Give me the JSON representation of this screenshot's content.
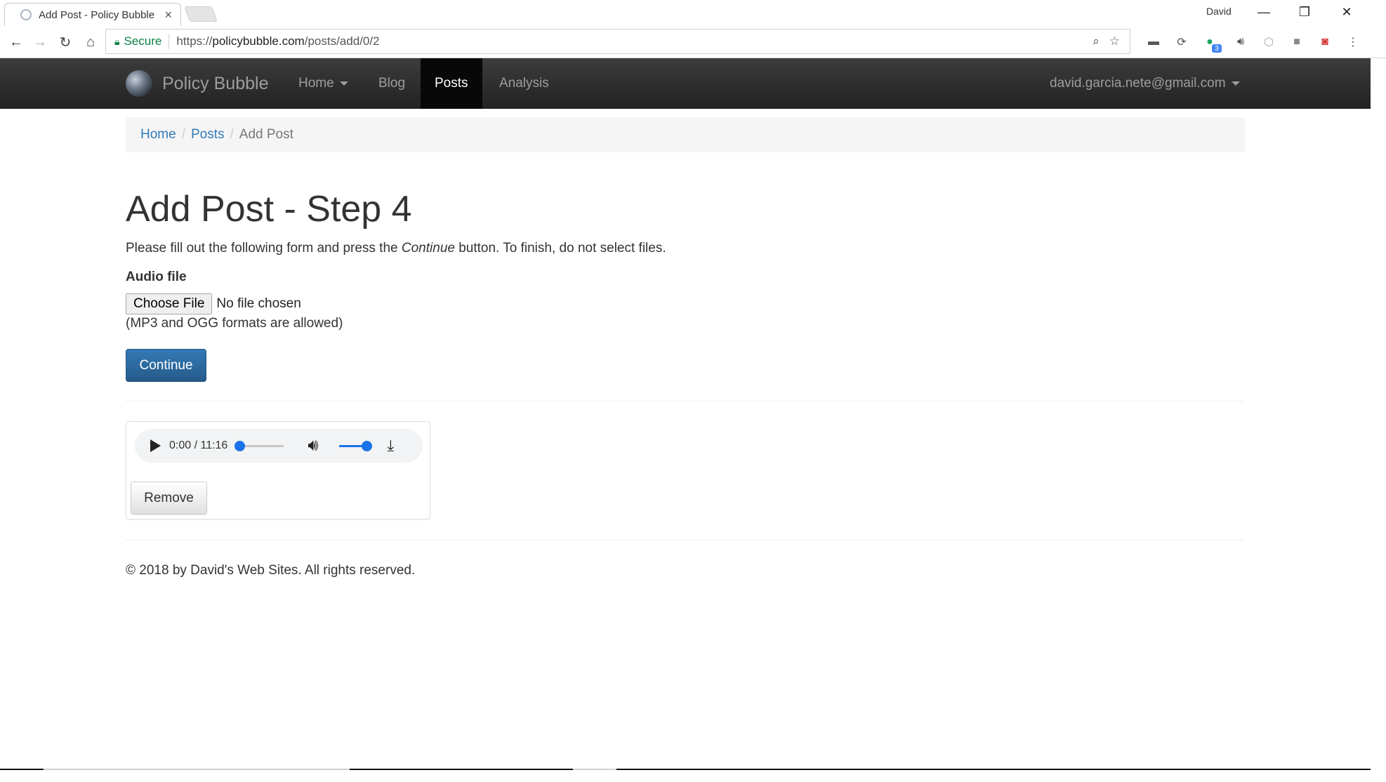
{
  "browser": {
    "tab_title": "Add Post - Policy Bubble",
    "tab_close": "×",
    "profile_name": "David",
    "window_controls": {
      "minimize": "—",
      "restore": "❐",
      "close": "✕"
    },
    "secure_label": "Secure",
    "url_scheme": "https://",
    "url_host": "policybubble.com",
    "url_path": "/posts/add/0/2",
    "extension_badge": "3"
  },
  "navbar": {
    "brand": "Policy Bubble",
    "items": [
      {
        "label": "Home"
      },
      {
        "label": "Blog"
      },
      {
        "label": "Posts"
      },
      {
        "label": "Analysis"
      }
    ],
    "active_item": "Posts",
    "user_email": "david.garcia.nete@gmail.com"
  },
  "breadcrumb": {
    "home": "Home",
    "posts": "Posts",
    "current": "Add Post",
    "divider": "/"
  },
  "page": {
    "title": "Add Post - Step 4",
    "intro_before": "Please fill out the following form and press the ",
    "intro_emphasis": "Continue",
    "intro_after": " button. To finish, do not select files."
  },
  "form": {
    "audio_label": "Audio file",
    "file_button": "Choose File",
    "file_status": "No file chosen",
    "help_text": "(MP3 and OGG formats are allowed)",
    "continue_label": "Continue"
  },
  "audio": {
    "time": "0:00 / 11:16",
    "progress_fraction": 0.0,
    "volume_fraction": 1.0,
    "remove_label": "Remove"
  },
  "footer": {
    "copyright": "© 2018 by David's Web Sites. All rights reserved."
  },
  "colors": {
    "navbar_bg": "#222222",
    "link": "#337ab7",
    "primary_button": "#337ab7",
    "secure_green": "#0b8043",
    "media_accent": "#1a73e8"
  }
}
